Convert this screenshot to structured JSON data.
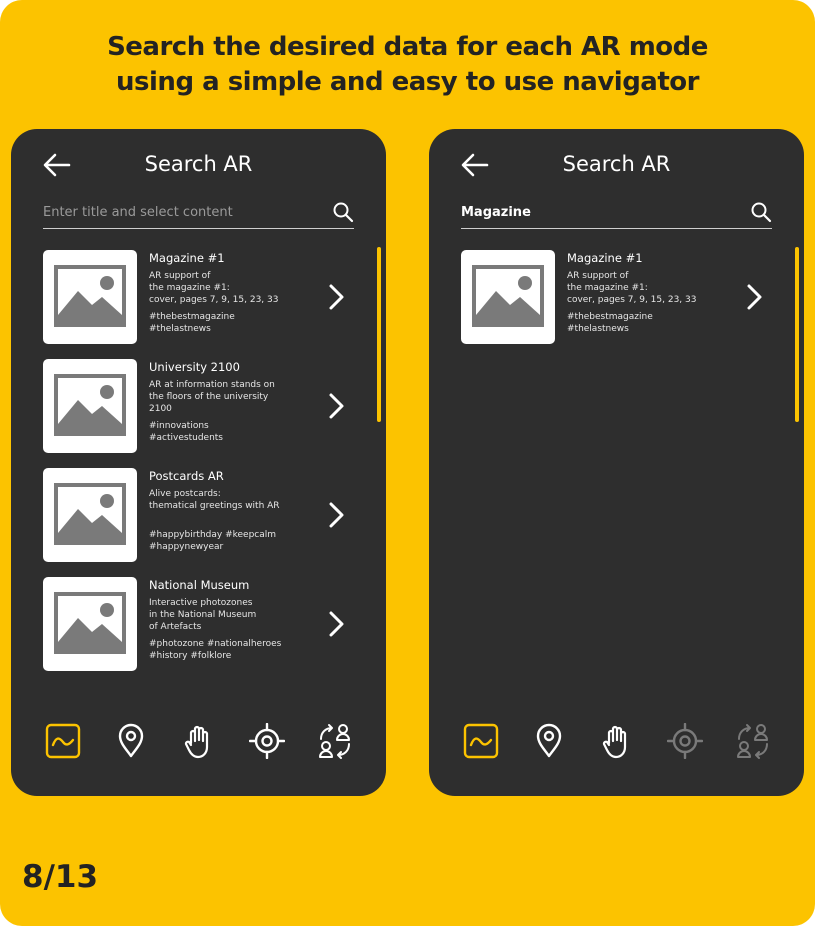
{
  "headline": {
    "line1": "Search the desired data for each AR mode",
    "line2": "using a simple and easy to use navigator"
  },
  "page_indicator": "8/13",
  "colors": {
    "accent": "#FCC300",
    "phone_background": "#2E2E2E",
    "text": "#FFFFFF",
    "disabled_icon": "#7A7A7A"
  },
  "screens": [
    {
      "title": "Search AR",
      "back_icon": "arrow-left-icon",
      "search": {
        "value": "",
        "placeholder": "Enter title and select content",
        "icon": "search-icon"
      },
      "results": [
        {
          "title": "Magazine #1",
          "description": "AR support of\nthe magazine #1:\ncover, pages 7, 9, 15, 23, 33",
          "tags": "#thebestmagazine\n#thelastnews"
        },
        {
          "title": "University 2100",
          "description": "AR at information stands on\nthe floors of the university\n2100",
          "tags": "#innovations\n#activestudents"
        },
        {
          "title": "Postcards AR",
          "description": "Alive postcards:\nthematical greetings with AR",
          "tags": "#happybirthday #keepcalm\n#happynewyear"
        },
        {
          "title": "National Museum",
          "description": "Interactive photozones\nin the National Museum\nof Artefacts",
          "tags": "#photozone #nationalheroes\n#history #folklore"
        }
      ],
      "tabs": [
        {
          "icon": "image-mode-icon",
          "state": "active"
        },
        {
          "icon": "location-pin-icon",
          "state": "enabled"
        },
        {
          "icon": "hand-icon",
          "state": "enabled"
        },
        {
          "icon": "target-icon",
          "state": "enabled"
        },
        {
          "icon": "user-switch-icon",
          "state": "enabled"
        }
      ]
    },
    {
      "title": "Search AR",
      "back_icon": "arrow-left-icon",
      "search": {
        "value": "Magazine",
        "placeholder": "Enter title and select content",
        "icon": "search-icon"
      },
      "results": [
        {
          "title": "Magazine #1",
          "description": "AR support of\nthe magazine #1:\ncover, pages 7, 9, 15, 23, 33",
          "tags": "#thebestmagazine\n#thelastnews"
        }
      ],
      "tabs": [
        {
          "icon": "image-mode-icon",
          "state": "active"
        },
        {
          "icon": "location-pin-icon",
          "state": "enabled"
        },
        {
          "icon": "hand-icon",
          "state": "enabled"
        },
        {
          "icon": "target-icon",
          "state": "disabled"
        },
        {
          "icon": "user-switch-icon",
          "state": "disabled"
        }
      ]
    }
  ]
}
